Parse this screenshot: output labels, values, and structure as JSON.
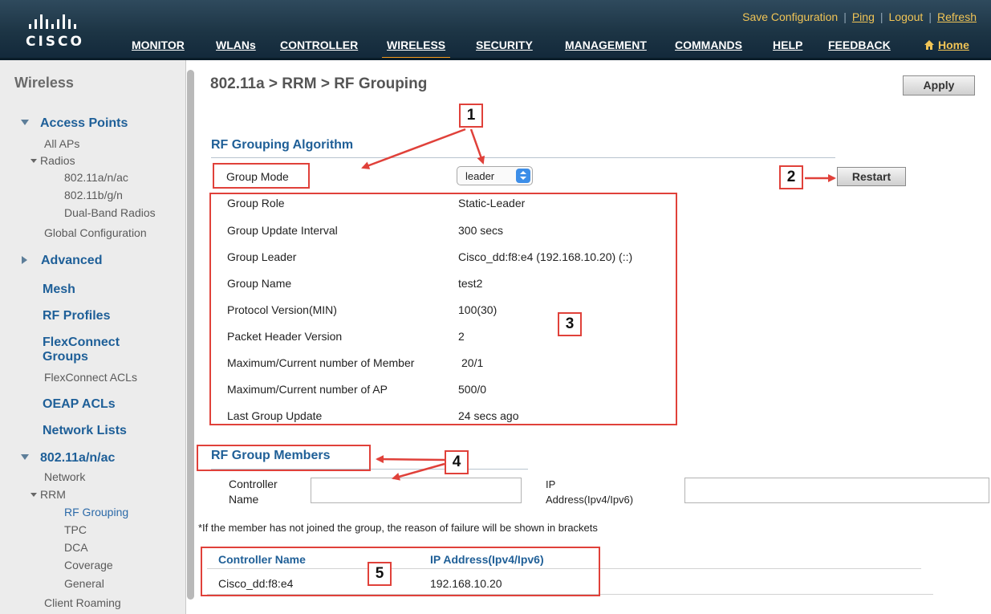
{
  "header": {
    "logo_text": "CISCO",
    "utility_links": [
      "Save Configuration",
      "Ping",
      "Logout",
      "Refresh"
    ],
    "nav": [
      "MONITOR",
      "WLANs",
      "CONTROLLER",
      "WIRELESS",
      "SECURITY",
      "MANAGEMENT",
      "COMMANDS",
      "HELP",
      "FEEDBACK",
      "Home"
    ],
    "active_nav": "WIRELESS",
    "accent_color": "#f39a1d"
  },
  "sidebar": {
    "title": "Wireless",
    "access_points": "Access Points",
    "all_aps": "All APs",
    "radios": "Radios",
    "radio_80211anac": "802.11a/n/ac",
    "radio_80211bgn": "802.11b/g/n",
    "dual_band": "Dual-Band Radios",
    "global_config": "Global Configuration",
    "advanced": "Advanced",
    "mesh": "Mesh",
    "rf_profiles": "RF Profiles",
    "flexconnect_1": "FlexConnect",
    "flexconnect_2": "Groups",
    "flexconnect_acls": "FlexConnect ACLs",
    "oeap_acls": "OEAP ACLs",
    "network_lists": "Network Lists",
    "band_80211anac": "802.11a/n/ac",
    "network": "Network",
    "rrm": "RRM",
    "rf_grouping": "RF Grouping",
    "tpc": "TPC",
    "dca": "DCA",
    "coverage": "Coverage",
    "general": "General",
    "client_roaming": "Client Roaming"
  },
  "main": {
    "page_title": "802.11a > RRM > RF Grouping",
    "apply_label": "Apply",
    "algorithm_title": "RF Grouping Algorithm",
    "group_mode_label": "Group Mode",
    "group_mode_value": "leader",
    "restart_label": "Restart",
    "properties": [
      {
        "label": "Group Role",
        "value": "Static-Leader"
      },
      {
        "label": "Group Update Interval",
        "value": "300 secs"
      },
      {
        "label": "Group Leader",
        "value": "Cisco_dd:f8:e4 (192.168.10.20) (::)"
      },
      {
        "label": "Group Name",
        "value": "test2"
      },
      {
        "label": "Protocol Version(MIN)",
        "value": "100(30)"
      },
      {
        "label": "Packet Header Version",
        "value": "2"
      },
      {
        "label": "Maximum/Current number of Member",
        "value": "20/1"
      },
      {
        "label": "Maximum/Current number of AP",
        "value": "500/0"
      },
      {
        "label": "Last Group Update",
        "value": "24 secs ago"
      }
    ],
    "members_title": "RF Group Members",
    "controller_name_label_1": "Controller",
    "controller_name_label_2": "Name",
    "controller_name_value": "",
    "ip_label_1": "IP",
    "ip_label_2": "Address(Ipv4/Ipv6)",
    "ip_value": "",
    "note": "*If the member has not joined the group, the reason of failure will be shown in brackets",
    "table": {
      "headers": [
        "Controller Name",
        "IP Address(Ipv4/Ipv6)"
      ],
      "rows": [
        [
          "Cisco_dd:f8:e4",
          "192.168.10.20"
        ]
      ]
    }
  },
  "annotations": {
    "callouts": [
      "1",
      "2",
      "3",
      "4",
      "5"
    ],
    "color": "#e0413a"
  }
}
